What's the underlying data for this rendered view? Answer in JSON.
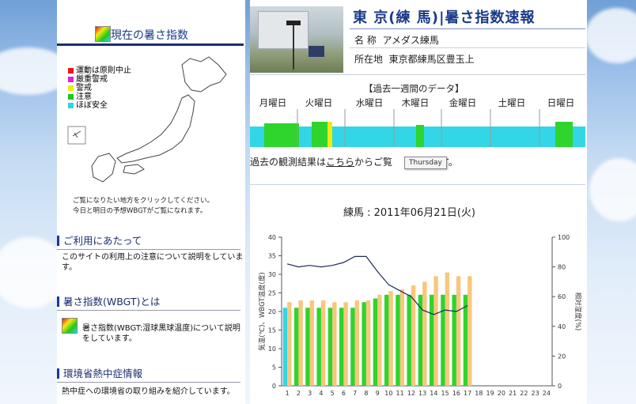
{
  "left_panel": {
    "title": "現在の暑さ指数",
    "legend": [
      {
        "label": "運動は原則中止",
        "color": "#e8141e"
      },
      {
        "label": "厳重警戒",
        "color": "#e61ec8"
      },
      {
        "label": "警戒",
        "color": "#f3ea10"
      },
      {
        "label": "注意",
        "color": "#1fc81c"
      },
      {
        "label": "ほぼ安全",
        "color": "#28d7e4"
      }
    ],
    "map_caption": [
      "ご覧になりたい地方をクリックしてください。",
      "今日と明日の予想WBGTがご覧になれます。"
    ],
    "sections": [
      {
        "title": "ご利用にあたって",
        "desc": "このサイトの利用上の注意について説明をしています。"
      },
      {
        "title": "暑さ指数(WBGT)とは",
        "desc": "暑さ指数(WBGT:湿球黒球温度)について説明をしています。"
      },
      {
        "title": "環境省熱中症情報",
        "desc": "熱中症への環境省の取り組みを紹介しています。"
      }
    ]
  },
  "header": {
    "title": "東 京(練 馬)|暑さ指数速報",
    "name_label": "名 称",
    "name_value": "アメダス練馬",
    "location_label": "所在地",
    "location_value": "東京都練馬区豊玉上"
  },
  "week": {
    "title": "【過去一週間のデータ】",
    "days": [
      "月曜日",
      "火曜日",
      "水曜日",
      "木曜日",
      "金曜日",
      "土曜日",
      "日曜日"
    ]
  },
  "past_results": {
    "prefix": "過去の観測結果は",
    "link": "こちら",
    "suffix_a": "からご覧",
    "suffix_b": "す。",
    "tooltip": "Thursday"
  },
  "chart_title": "練馬 : 2011年06月21日(火)",
  "colors": {
    "title_blue": "#1a3a8a",
    "bar_orange": "#f8c77c",
    "bar_green": "#2fd42c",
    "bar_cyan": "#33d6e6",
    "line": "#1b2a5e"
  },
  "chart_data": {
    "type": "bar",
    "x": [
      1,
      2,
      3,
      4,
      5,
      6,
      7,
      8,
      9,
      10,
      11,
      12,
      13,
      14,
      15,
      16,
      17,
      18,
      19,
      20,
      21,
      22,
      23,
      24
    ],
    "left_ylabel": "気温(℃)、WBGT温度(度)",
    "right_ylabel": "相対湿度(%)",
    "left_ylim": [
      0,
      40
    ],
    "left_ticks": [
      0,
      5,
      10,
      15,
      20,
      25,
      30,
      35,
      40
    ],
    "right_ylim": [
      0,
      100
    ],
    "right_ticks": [
      0,
      20,
      40,
      60,
      80,
      100
    ],
    "series": [
      {
        "kind": "bar",
        "axis": "left",
        "values": [
          22.5,
          23,
          23,
          23,
          22.5,
          22.5,
          23,
          23,
          24.5,
          25.5,
          26,
          27,
          28,
          29.5,
          30.5,
          29.5,
          29.5,
          null,
          null,
          null,
          null,
          null,
          null,
          null
        ]
      },
      {
        "kind": "bar",
        "axis": "left",
        "values": [
          21,
          21,
          21,
          21,
          21,
          21,
          21,
          22.5,
          23.5,
          24.5,
          24.5,
          24.5,
          24.5,
          24.5,
          24.5,
          24.5,
          24.5,
          null,
          null,
          null,
          null,
          null,
          null,
          null
        ]
      },
      {
        "kind": "line",
        "axis": "right",
        "values": [
          82,
          80,
          81,
          80,
          81,
          83,
          87,
          87,
          77,
          68,
          64,
          60,
          51,
          48,
          51,
          50,
          54,
          null,
          null,
          null,
          null,
          null,
          null,
          null
        ]
      }
    ]
  }
}
